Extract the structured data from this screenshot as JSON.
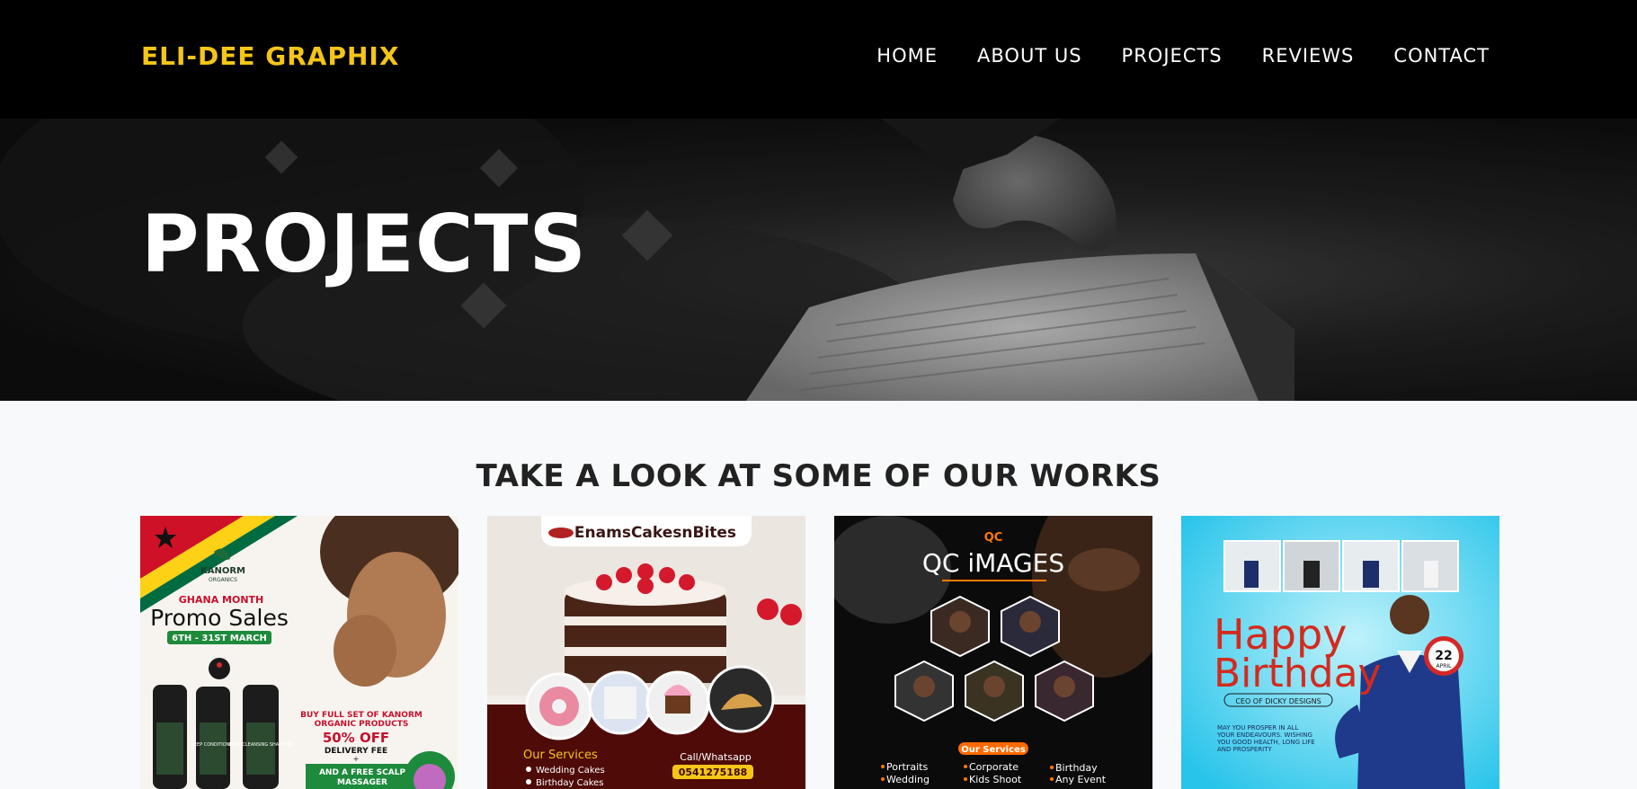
{
  "brand": "ELI-DEE GRAPHIX",
  "nav": [
    "HOME",
    "ABOUT US",
    "PROJECTS",
    "REVIEWS",
    "CONTACT"
  ],
  "hero": {
    "title": "PROJECTS"
  },
  "works": {
    "title": "TAKE A LOOK AT SOME OF OUR WORKS",
    "cards": [
      {
        "logo": "KANORM",
        "logo_sub": "ORGANICS",
        "kicker": "GHANA MONTH",
        "headline": "Promo Sales",
        "dates": "6TH - 31ST MARCH",
        "offer_line1": "BUY FULL SET OF KANORM",
        "offer_line2": "ORGANIC PRODUCTS",
        "discount": "50% OFF",
        "delivery": "DELIVERY FEE",
        "plus": "+",
        "bonus_line1": "AND A FREE SCALP",
        "bonus_line2": "MASSAGER",
        "bottle1": "DEEP CONDITIONER",
        "bottle2": "DEEP CLEANSING SHAMPOO"
      },
      {
        "brand": "EnamsCakesnBites",
        "services_title": "Our Services",
        "service1": "Wedding Cakes",
        "service2": "Birthday Cakes",
        "call_label": "Call/Whatsapp",
        "phone": "0541275188"
      },
      {
        "logo": "QC",
        "brand": "QC iMAGES",
        "services_title": "Our Services",
        "col1": [
          "Portraits",
          "Wedding"
        ],
        "col2": [
          "Corporate",
          "Kids Shoot"
        ],
        "col3": [
          "Birthday",
          "Any Event"
        ]
      },
      {
        "title1": "Happy",
        "title2": "Birthday",
        "subtitle": "CEO OF DICKY DESIGNS",
        "day": "22",
        "month": "APRIL",
        "wish1": "MAY YOU PROSPER IN ALL",
        "wish2": "YOUR ENDEAVOURS. WISHING",
        "wish3": "YOU GOOD HEALTH, LONG LIFE",
        "wish4": "AND PROSPERITY"
      }
    ]
  },
  "colors": {
    "accent": "#f5c518",
    "navbar_bg": "#000000",
    "page_bg": "#f8f9fa"
  },
  "icons": [
    "cake-logo-icon",
    "qc-logo-icon",
    "ghana-flag-icon"
  ]
}
